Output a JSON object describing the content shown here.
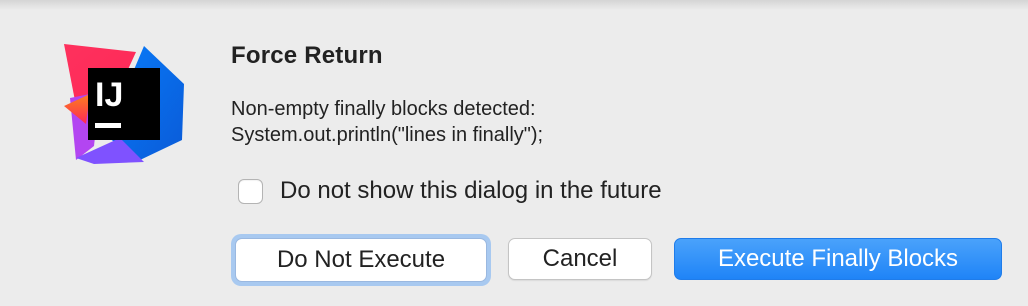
{
  "dialog": {
    "title": "Force Return",
    "message_lines": [
      "Non-empty finally blocks detected:",
      "System.out.println(\"lines in finally\");"
    ],
    "checkbox": {
      "label": "Do not show this dialog in the future",
      "checked": false
    },
    "buttons": {
      "do_not_execute": "Do Not Execute",
      "cancel": "Cancel",
      "execute_finally": "Execute Finally Blocks"
    },
    "app_icon": {
      "name": "intellij-idea-icon",
      "text": "IJ"
    },
    "colors": {
      "primary_button": "#1f84f7",
      "focus_ring": "#a8c9f0",
      "background": "#ececec"
    }
  }
}
